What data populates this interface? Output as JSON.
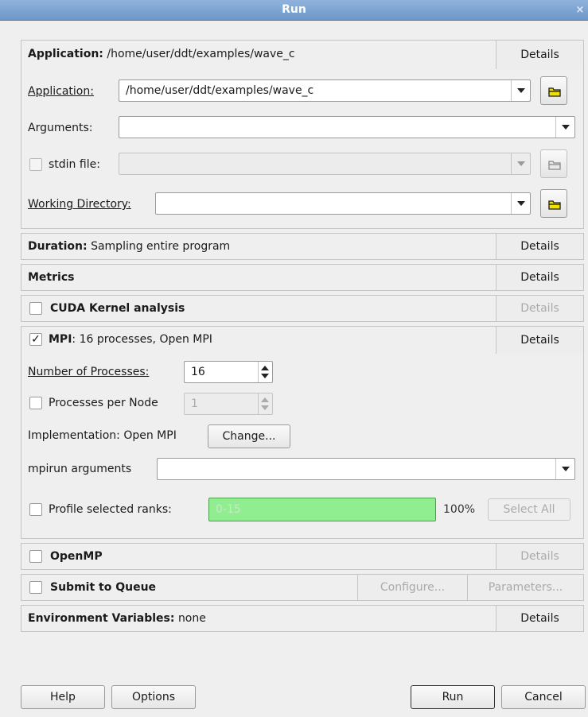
{
  "window": {
    "title": "Run",
    "close_glyph": "×"
  },
  "application_section": {
    "header_label": "Application:",
    "header_value": "/home/user/ddt/examples/wave_c",
    "details_label": "Details",
    "application_label": "Application:",
    "application_value": "/home/user/ddt/examples/wave_c",
    "arguments_label": "Arguments:",
    "arguments_value": "",
    "stdin_label": "stdin file:",
    "stdin_checked": false,
    "stdin_value": "",
    "working_dir_label": "Working Directory:",
    "working_dir_value": ""
  },
  "duration_section": {
    "header_label": "Duration:",
    "header_value": "Sampling entire program",
    "details_label": "Details"
  },
  "metrics_section": {
    "header_label": "Metrics",
    "details_label": "Details"
  },
  "cuda_section": {
    "header_label": "CUDA Kernel analysis",
    "checked": false,
    "details_label": "Details"
  },
  "mpi_section": {
    "checked": true,
    "check_glyph": "✓",
    "header_label": "MPI",
    "header_value": ": 16 processes, Open MPI",
    "details_label": "Details",
    "num_processes_label": "Number of Processes:",
    "num_processes_value": "16",
    "processes_per_node_label": "Processes per Node",
    "processes_per_node_checked": false,
    "processes_per_node_value": "1",
    "implementation_label": "Implementation: Open MPI",
    "change_label": "Change...",
    "mpirun_args_label": "mpirun arguments",
    "mpirun_args_value": "",
    "profile_ranks_label": "Profile selected ranks:",
    "profile_ranks_checked": false,
    "profile_ranks_value": "0-15",
    "profile_ranks_percent": "100%",
    "select_all_label": "Select All"
  },
  "openmp_section": {
    "header_label": "OpenMP",
    "checked": false,
    "details_label": "Details"
  },
  "queue_section": {
    "header_label": "Submit to Queue",
    "checked": false,
    "configure_label": "Configure...",
    "parameters_label": "Parameters..."
  },
  "env_section": {
    "header_label": "Environment Variables:",
    "header_value": "none",
    "details_label": "Details"
  },
  "footer": {
    "help_label": "Help",
    "options_label": "Options",
    "run_label": "Run",
    "cancel_label": "Cancel"
  },
  "colors": {
    "titlebar": "#7ba2d2",
    "ranks_field_fill": "#90ee90",
    "folder_icon": "#f0e000"
  },
  "icons": {
    "folder": "folder-icon",
    "dropdown": "chevron-down-icon",
    "check": "checkmark-icon"
  }
}
